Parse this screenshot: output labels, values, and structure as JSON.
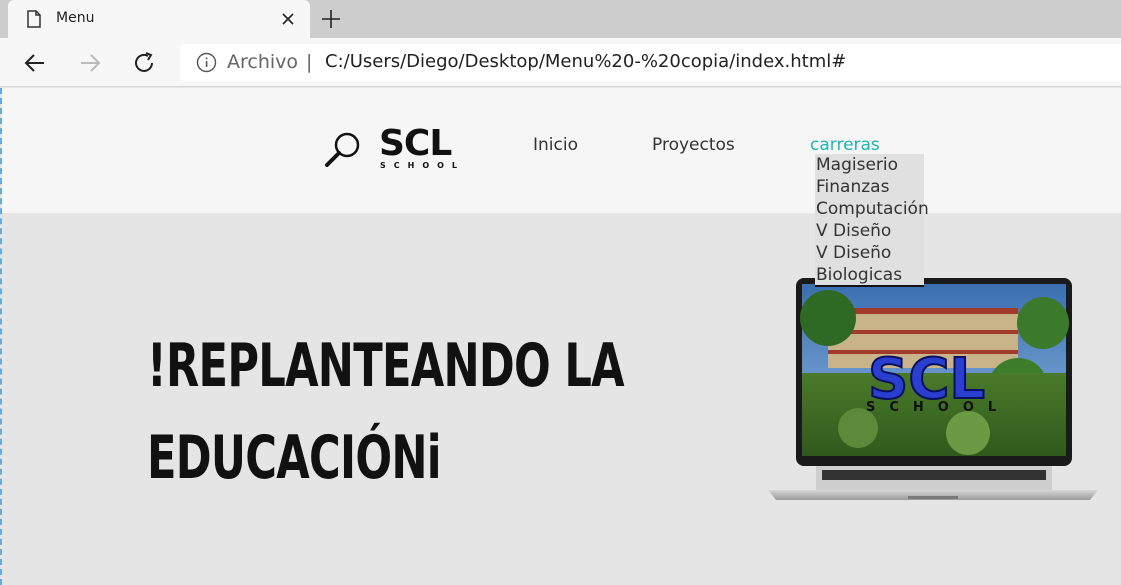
{
  "browser": {
    "tab_title": "Menu",
    "address_origin": "Archivo",
    "address_separator": "|",
    "address_url": "C:/Users/Diego/Desktop/Menu%20-%20copia/index.html#"
  },
  "site": {
    "logo_main": "SCL",
    "logo_sub": "SCHOOL",
    "nav": {
      "inicio": "Inicio",
      "proyectos": "Proyectos",
      "carreras": "carreras"
    },
    "dropdown": [
      "Magiserio",
      "Finanzas",
      "Computación",
      "V Diseño",
      "V Diseño",
      "Biologicas"
    ],
    "headline_line1": "!REPLANTEANDO LA",
    "headline_line2": "EDUCACIÓNi",
    "screen_logo_main": "SCL",
    "screen_logo_sub": "SCHOOL"
  },
  "colors": {
    "accent": "#1db5b5",
    "header_bg": "#f6f6f6",
    "page_bg": "#e5e5e5"
  }
}
